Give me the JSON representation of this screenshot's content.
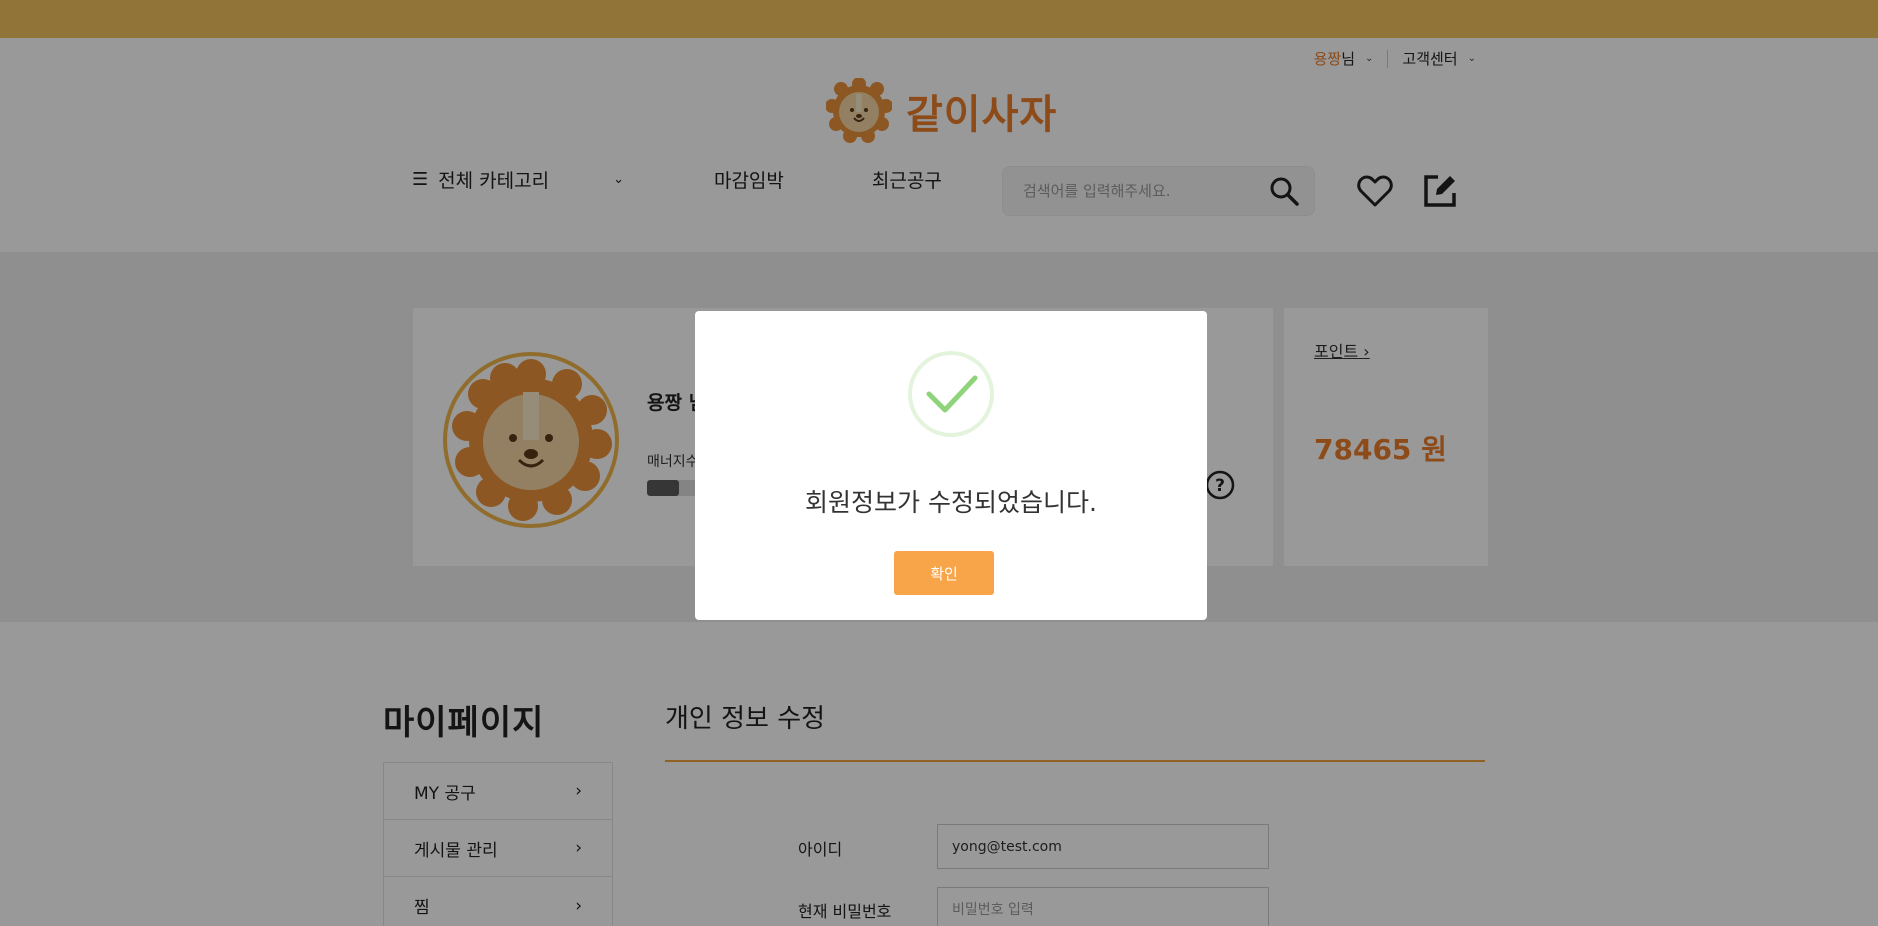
{
  "header": {
    "user_name": "용짱",
    "user_suffix": "님",
    "customer_center": "고객센터",
    "logo_text": "같이사자"
  },
  "nav": {
    "all_categories": "전체 카테고리",
    "closing_soon": "마감임박",
    "recent_group_buy": "최근공구",
    "search_placeholder": "검색어를 입력해주세요."
  },
  "profile": {
    "name": "용짱 님",
    "manner_label": "매너지수",
    "manner_fraction": 0.06
  },
  "points": {
    "label": "포인트",
    "value": "78465 원"
  },
  "mypage": {
    "title": "마이페이지",
    "menu": [
      "MY 공구",
      "게시물 관리",
      "찜"
    ]
  },
  "edit_section": {
    "title": "개인 정보 수정",
    "id_label": "아이디",
    "id_value": "yong@test.com",
    "current_password_label": "현재 비밀번호",
    "current_password_placeholder": "비밀번호 입력"
  },
  "modal": {
    "message": "회원정보가 수정되었습니다.",
    "confirm_label": "확인"
  },
  "colors": {
    "accent": "#e97d2a",
    "banner": "#f0c15e",
    "button": "#f8a54a",
    "check": "#8fd47b"
  }
}
